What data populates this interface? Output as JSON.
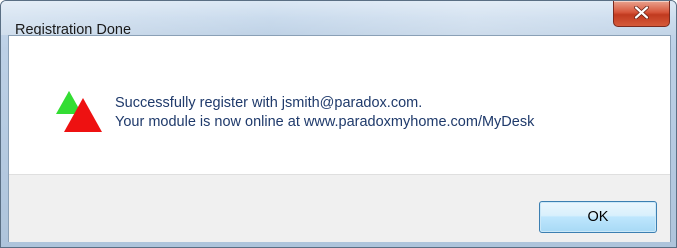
{
  "window": {
    "title": "Registration Done",
    "close_icon": "close-icon"
  },
  "message": {
    "line1": "Successfully register with jsmith@paradox.com.",
    "line2": "Your module is now online at www.paradoxmyhome.com/MyDesk",
    "icon": "triangles-logo-icon"
  },
  "buttons": {
    "ok_label": "OK"
  },
  "colors": {
    "title_bar": "#c4d7eb",
    "close_button": "#c13a1f",
    "message_text": "#1f3a6b",
    "footer_bg": "#f0f0f0",
    "ok_border": "#3c7fb1",
    "icon_green": "#33dd33",
    "icon_red": "#ee1111"
  }
}
